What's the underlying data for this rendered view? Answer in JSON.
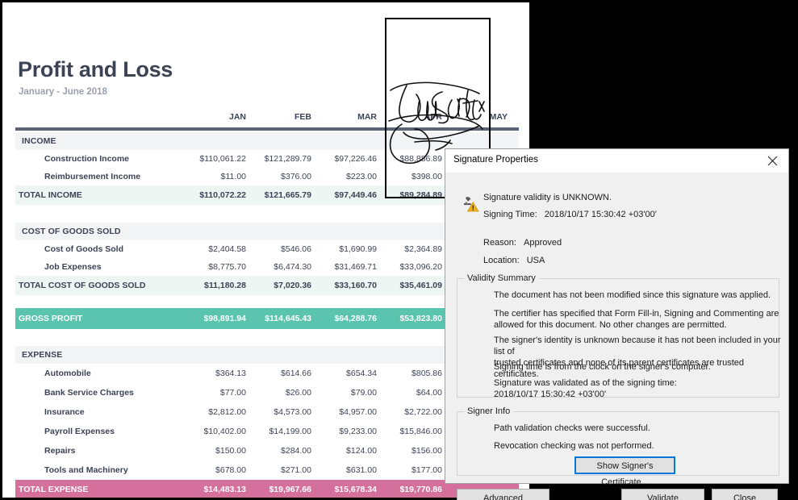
{
  "document": {
    "title": "Profit and Loss",
    "subtitle": "January - June 2018",
    "columns": [
      "JAN",
      "FEB",
      "MAR",
      "APR",
      "MAY"
    ],
    "sections": [
      {
        "name": "INCOME",
        "rows": [
          {
            "label": "Construction Income",
            "values": [
              "$110,061.22",
              "$121,289.79",
              "$97,226.46",
              "$88,886.89",
              ""
            ]
          },
          {
            "label": "Reimbursement Income",
            "values": [
              "$11.00",
              "$376.00",
              "$223.00",
              "$398.00",
              ""
            ]
          }
        ],
        "total": {
          "label": "TOTAL INCOME",
          "values": [
            "$110,072.22",
            "$121,665.79",
            "$97,449.46",
            "$89,284.89",
            ""
          ]
        }
      },
      {
        "name": "COST OF GOODS SOLD",
        "rows": [
          {
            "label": "Cost of Goods Sold",
            "values": [
              "$2,404.58",
              "$546.06",
              "$1,690.99",
              "$2,364.89",
              ""
            ]
          },
          {
            "label": "Job Expenses",
            "values": [
              "$8,775.70",
              "$6,474.30",
              "$31,469.71",
              "$33,096.20",
              ""
            ]
          }
        ],
        "total": {
          "label": "TOTAL COST OF GOODS SOLD",
          "values": [
            "$11,180.28",
            "$7,020.36",
            "$33,160.70",
            "$35,461.09",
            ""
          ]
        }
      }
    ],
    "gross_profit": {
      "label": "GROSS PROFIT",
      "values": [
        "$98,891.94",
        "$114,645.43",
        "$64,288.76",
        "$53,823.80",
        ""
      ]
    },
    "expense": {
      "name": "EXPENSE",
      "rows": [
        {
          "label": "Automobile",
          "values": [
            "$364.13",
            "$614.66",
            "$654.34",
            "$805.86",
            ""
          ]
        },
        {
          "label": "Bank Service Charges",
          "values": [
            "$77.00",
            "$26.00",
            "$79.00",
            "$64.00",
            ""
          ]
        },
        {
          "label": "Insurance",
          "values": [
            "$2,812.00",
            "$4,573.00",
            "$4,957.00",
            "$2,722.00",
            ""
          ]
        },
        {
          "label": "Payroll Expenses",
          "values": [
            "$10,402.00",
            "$14,199.00",
            "$9,233.00",
            "$15,846.00",
            ""
          ]
        },
        {
          "label": "Repairs",
          "values": [
            "$150.00",
            "$284.00",
            "$124.00",
            "$156.00",
            ""
          ]
        },
        {
          "label": "Tools and Machinery",
          "values": [
            "$678.00",
            "$271.00",
            "$631.00",
            "$177.00",
            ""
          ]
        }
      ],
      "total": {
        "label": "TOTAL EXPENSE",
        "values": [
          "$14,483.13",
          "$19,967.66",
          "$15,678.34",
          "$19,770.86",
          ""
        ]
      }
    },
    "signature_stamp": {
      "name": "signature-stamp-box",
      "ink_label": "John Smith"
    }
  },
  "dialog": {
    "title": "Signature Properties",
    "close_icon": "close-icon",
    "status_icon": "signature-warning-icon",
    "validity": "Signature validity is UNKNOWN.",
    "signing_time_label": "Signing Time:",
    "signing_time_value": "2018/10/17 15:30:42 +03'00'",
    "reason_label": "Reason:",
    "reason_value": "Approved",
    "location_label": "Location:",
    "location_value": "USA",
    "validity_summary": {
      "legend": "Validity Summary",
      "paragraphs": [
        "The document has not been modified since this signature was applied.",
        "The certifier has specified that Form Fill-in, Signing and Commenting are\nallowed for this document. No other changes are permitted.",
        "The signer's identity is unknown because it has not been included in your list of\ntrusted certificates and none of its parent certificates are trusted certificates.",
        "Signing time is from the clock on the signer's computer.",
        "Signature was validated as of the signing time:\n2018/10/17 15:30:42 +03'00'"
      ]
    },
    "signer_info": {
      "legend": "Signer Info",
      "paragraphs": [
        "Path validation checks were successful.",
        "Revocation checking was not performed."
      ],
      "show_certificate_button": "Show Signer's Certificate..."
    },
    "buttons": {
      "advanced_properties": "Advanced Properties...",
      "validate_signature": "Validate Signature",
      "close": "Close"
    }
  },
  "colors": {
    "accent_teal": "#5BC4AE",
    "accent_pink": "#D4709B",
    "text_dark": "#3B4354",
    "rule": "#5C6576",
    "section_band": "#F3F4F6",
    "total_band": "#EEF6F4",
    "focus_blue": "#0078D7"
  }
}
